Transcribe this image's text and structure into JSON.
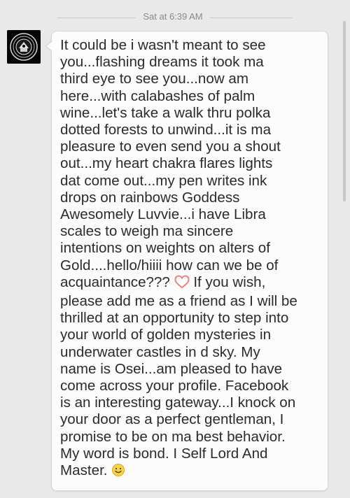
{
  "conversation": {
    "timestamp": "Sat at 6:39 AM"
  },
  "message": {
    "sender_avatar_icon": "emblem-avatar-icon",
    "text_part1": "It could be i wasn't meant to see\nyou...flashing dreams it took ma\nthird eye to see you...now am\nhere...with calabashes of palm\nwine...let's take a walk thru polka\ndotted forests to unwind...it is ma\npleasure to even send you a shout\nout...my heart chakra flares lights\ndat come out...my pen writes ink\ndrops on rainbows Goddess\nAwesomely Luvvie...i have Libra\nscales to weigh ma sincere\nintentions on weights on alters of\nGold....hello/hiiii how can we be of\nacquaintance??? ",
    "heart_icon": "heart-icon",
    "text_part2": " If you wish,\nplease add me as a friend as I will be\nthrilled at an opportunity to step into\nyour world of golden mysteries in\nunderwater castles in d sky. My\nname is Osei...am pleased to have\ncome across your profile. Facebook\nis an interesting gateway...I knock on\nyour door as a perfect gentleman, I\npromise to be on ma best behavior.\nMy word is bond. I Self Lord And\nMaster. ",
    "smile_icon": "smiley-icon"
  },
  "colors": {
    "background": "#e9e9e9",
    "bubble": "#fcfcfc",
    "text": "#2b2b2b",
    "timestamp": "#8a8a8a",
    "heart": "#f08080",
    "smiley": "#f2c230"
  }
}
